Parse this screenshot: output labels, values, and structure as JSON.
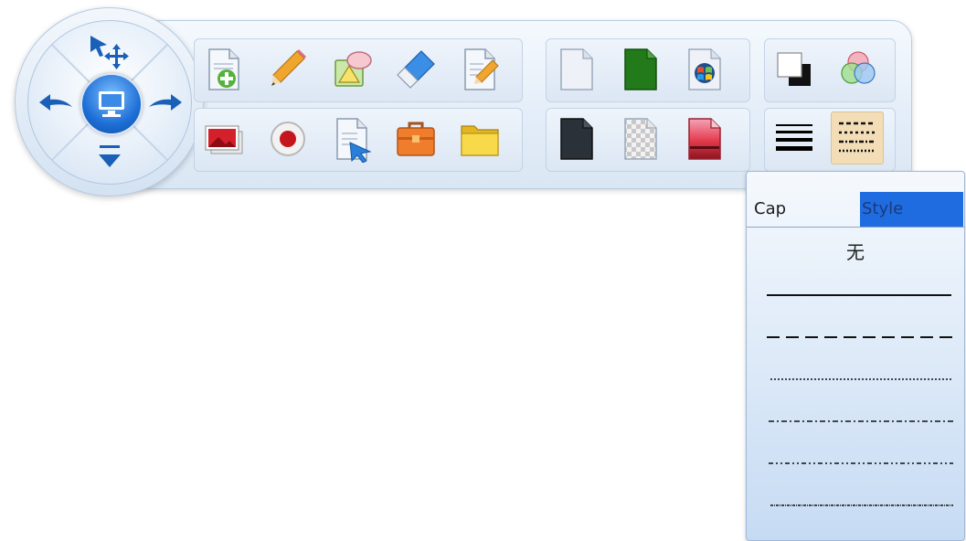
{
  "toolbar": {
    "joystick": {
      "select_move": "select-move-icon",
      "prev": "arrow-left-icon",
      "next": "arrow-right-icon",
      "center": "monitor-icon",
      "collapse": "collapse-down-icon"
    },
    "row1": [
      "new-page-icon",
      "pencil-icon",
      "shapes-icon",
      "eraser-icon",
      "edit-document-icon"
    ],
    "row2": [
      "picture-icon",
      "record-icon",
      "export-document-icon",
      "toolbox-icon",
      "folder-icon"
    ],
    "backgrounds_row1": [
      "white-background-icon",
      "green-background-icon",
      "desktop-background-icon"
    ],
    "backgrounds_row2": [
      "black-background-icon",
      "transparent-background-icon",
      "image-background-icon"
    ],
    "right_row1": [
      "color-swatch-icon",
      "color-mix-icon"
    ],
    "right_row2": [
      "line-width-icon",
      "line-style-icon"
    ]
  },
  "dropdown": {
    "tab_cap": "Cap",
    "tab_style": "Style",
    "none_label": "无",
    "styles": [
      "solid",
      "dash",
      "dot",
      "dash-dot",
      "dash-dot-dot",
      "dense-dot"
    ]
  }
}
